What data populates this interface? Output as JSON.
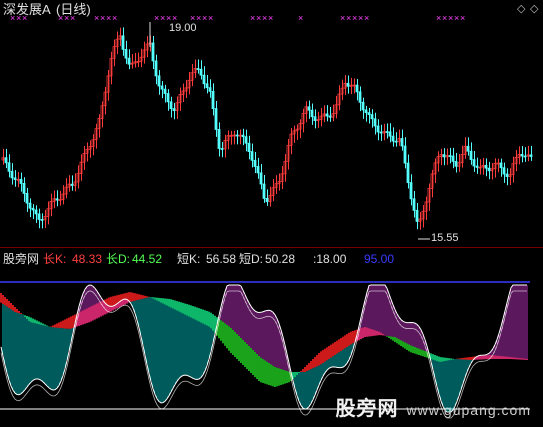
{
  "header": {
    "title": "深发展A",
    "period": "(日线)"
  },
  "window_controls": {
    "up": "◇",
    "close": "◇"
  },
  "main_panel": {
    "high_label": "19.00",
    "low_label": "15.55",
    "signal_marks": "×"
  },
  "indicator_panel": {
    "name": "股旁网",
    "long_k_label": "长K:",
    "long_k_value": "48.33",
    "long_d_label": "长D:",
    "long_d_value": "44.52",
    "short_k_label": "短K:",
    "short_k_value": "56.58",
    "short_d_label": "短D:",
    "short_d_value": "50.28",
    "line1_value": ":18.00",
    "line2_value": "95.00"
  },
  "watermark": {
    "site_name": "股旁网",
    "url": "www.gupang.com"
  },
  "colors": {
    "up_candle": "#ff3c3c",
    "down_candle": "#54ffff",
    "marker": "#ff44ff",
    "long_k": "#ff4040",
    "long_d": "#54ff54",
    "short_k": "#ffffff",
    "short_d": "#ffffff",
    "line_95": "#3a3aff",
    "line_18": "#ffffff",
    "hist_positive": "#ff2020",
    "hist_negative": "#22cc22",
    "hist_magenta": "#ff44ff",
    "hist_aqua": "#00ffff"
  }
}
